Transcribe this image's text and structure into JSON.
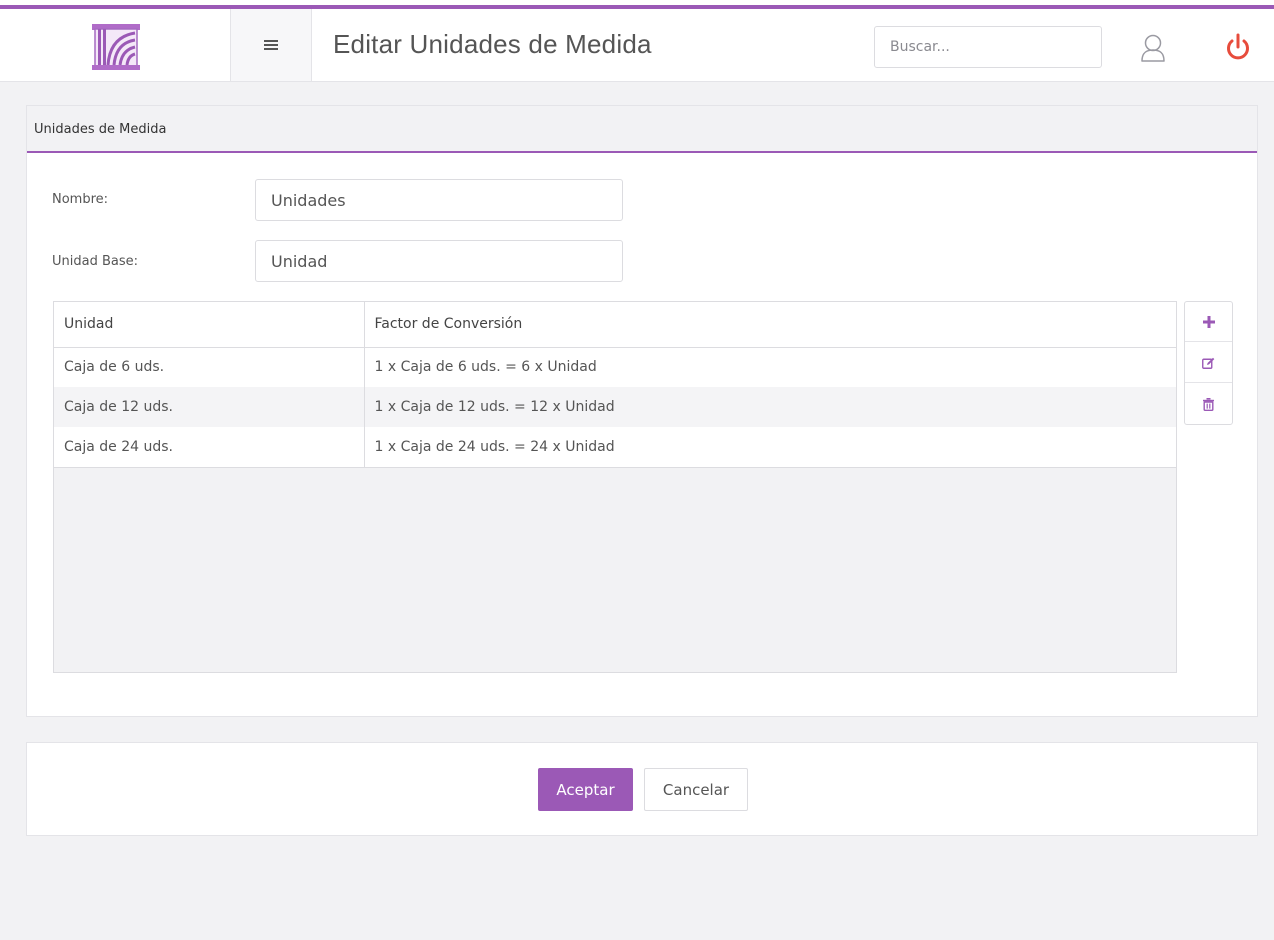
{
  "header": {
    "title": "Editar Unidades de Medida",
    "search_placeholder": "Buscar...",
    "logo_icon": "building-columns-logo",
    "menu_icon": "hamburger-icon",
    "user_icon": "user-icon",
    "power_icon": "power-icon"
  },
  "form": {
    "section_title": "Unidades de Medida",
    "nombre_label": "Nombre:",
    "nombre_value": "Unidades",
    "unidad_base_label": "Unidad Base:",
    "unidad_base_value": "Unidad"
  },
  "table": {
    "columns": [
      "Unidad",
      "Factor de Conversión"
    ],
    "rows": [
      {
        "unidad": "Caja de 6 uds.",
        "factor": "1 x Caja de 6 uds. = 6 x Unidad"
      },
      {
        "unidad": "Caja de 12 uds.",
        "factor": "1 x Caja de 12 uds. = 12 x Unidad"
      },
      {
        "unidad": "Caja de 24 uds.",
        "factor": "1 x Caja de 24 uds. = 24 x Unidad"
      }
    ]
  },
  "toolbar": {
    "icons": [
      "plus-icon",
      "edit-icon",
      "trash-icon"
    ]
  },
  "actions": {
    "accept_label": "Aceptar",
    "cancel_label": "Cancelar"
  },
  "colors": {
    "accent": "#9b59b6",
    "power": "#e74c3c"
  }
}
